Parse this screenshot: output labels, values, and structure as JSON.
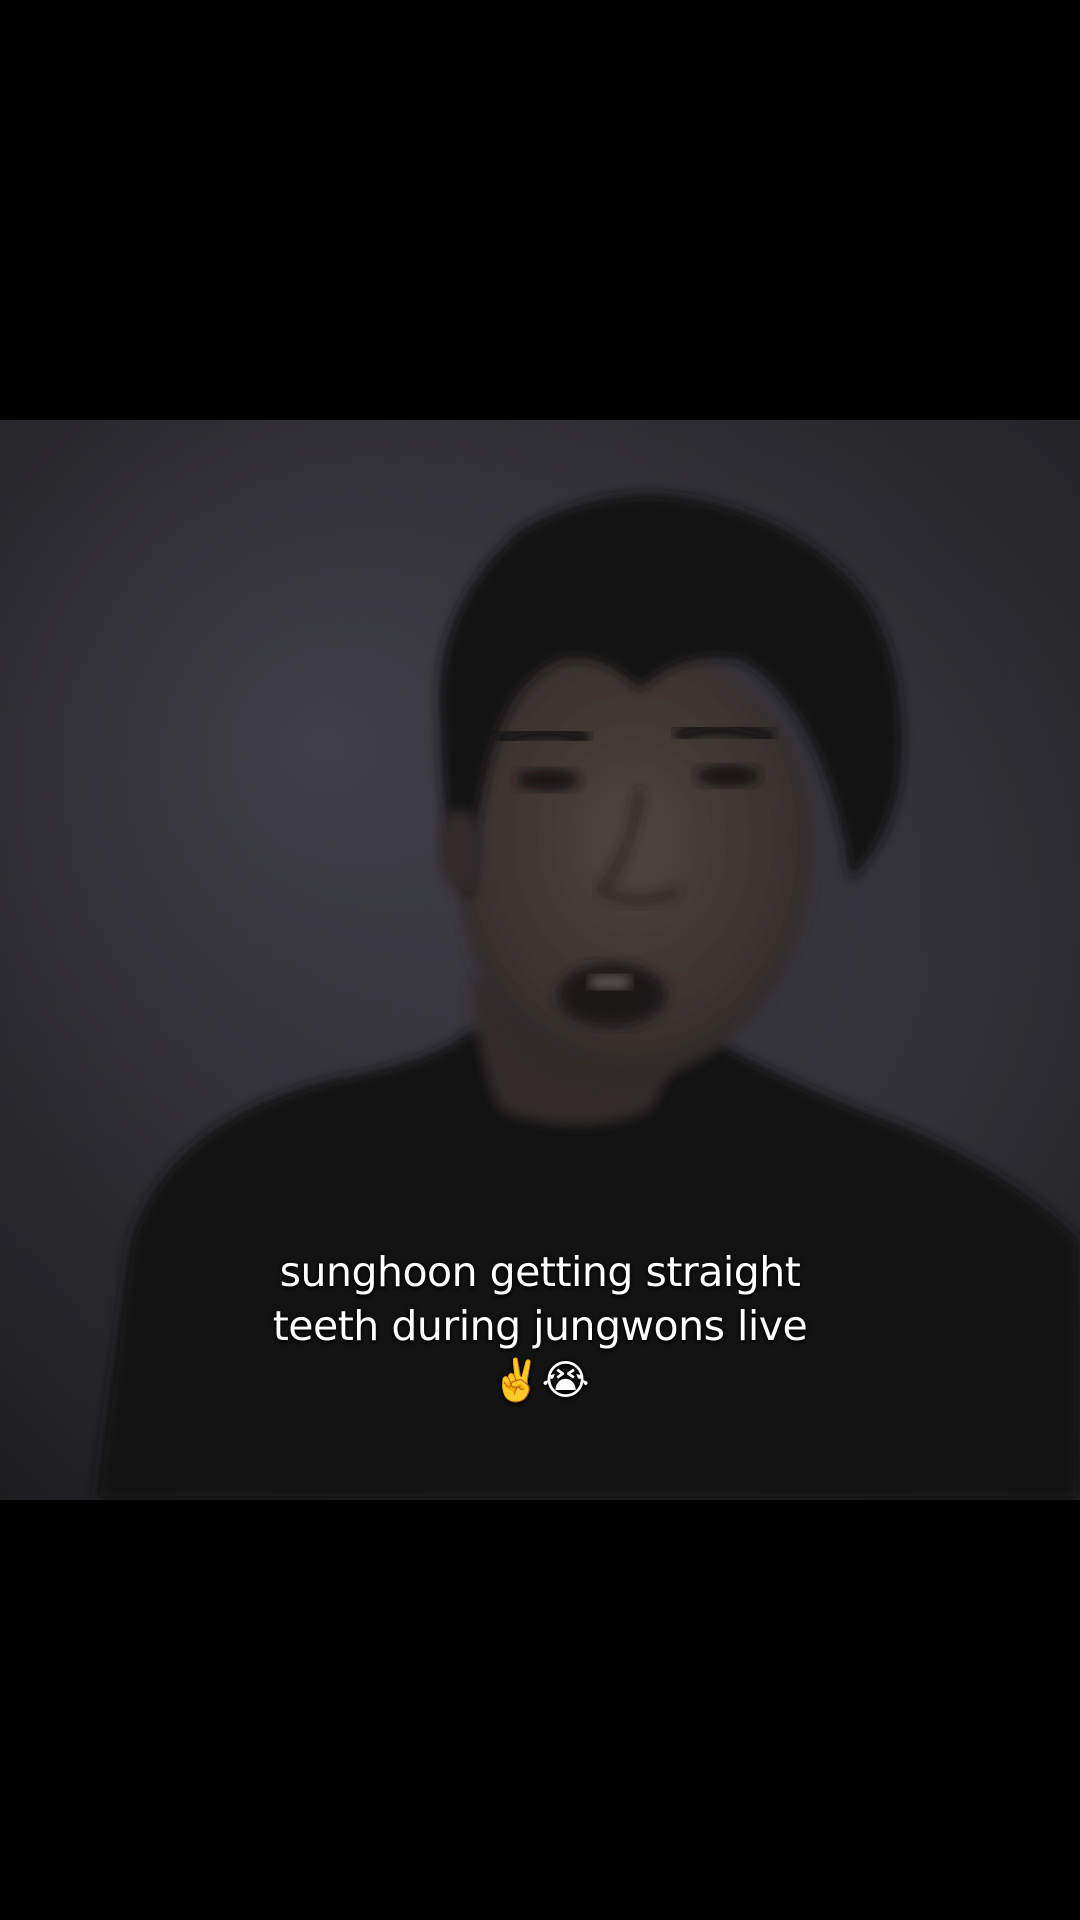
{
  "caption": {
    "line1": "sunghoon getting straight",
    "line2": "teeth during jungwons live",
    "line3": "✌️😭"
  },
  "colors": {
    "letterbox": "#000000",
    "wall": "#3b3a41",
    "hair": "#151315",
    "shirt": "#161517",
    "skin": "#4a403c",
    "caption_text": "#ffffff"
  }
}
